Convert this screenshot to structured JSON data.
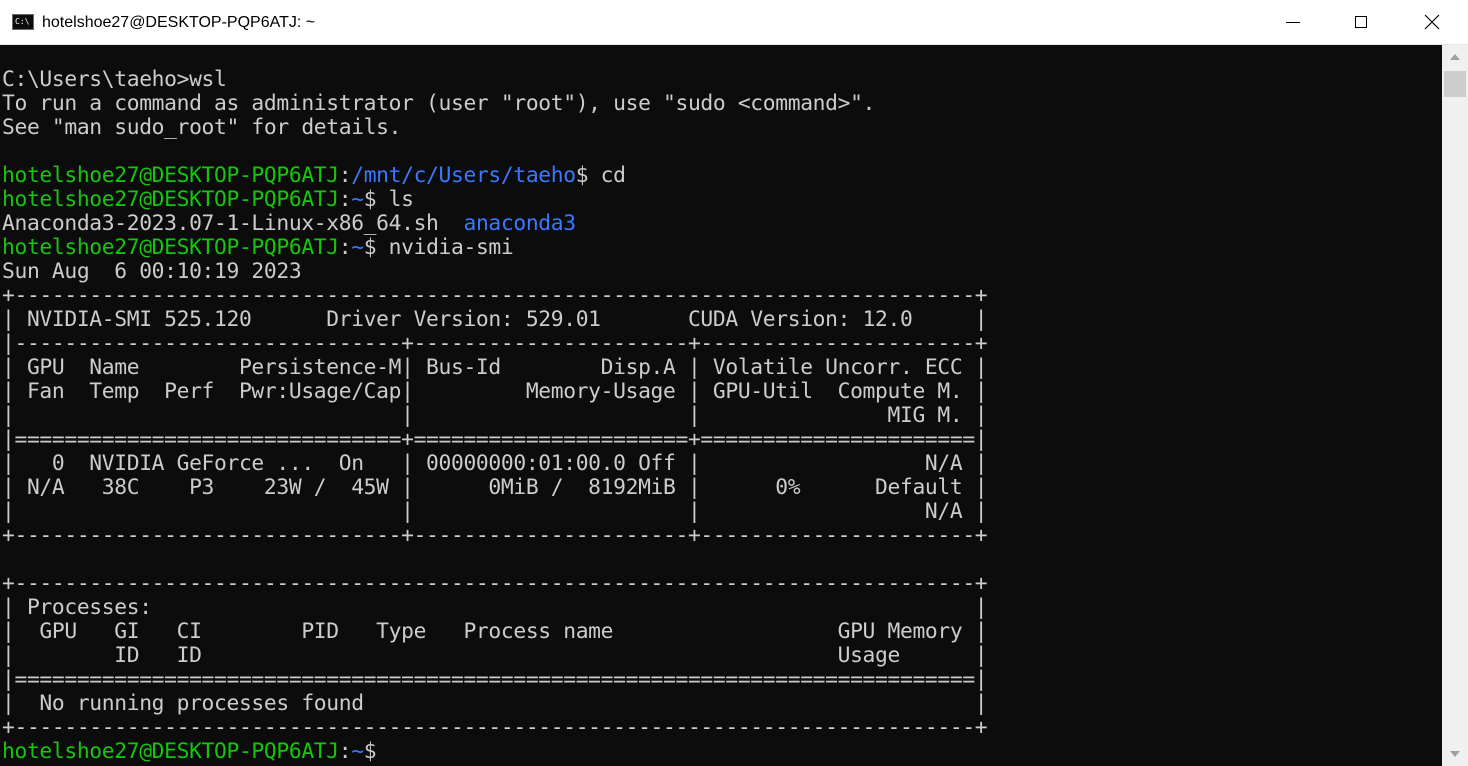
{
  "window": {
    "title": "hotelshoe27@DESKTOP-PQP6ATJ: ~",
    "icon": "C:\\",
    "icon_name": "command-prompt-icon"
  },
  "colors": {
    "background": "#0c0c0c",
    "text": "#cccccc",
    "prompt_user": "#16c60c",
    "prompt_path": "#3b78ff"
  },
  "terminal": {
    "lines": [
      {
        "segments": [
          {
            "text": "C:\\Users\\taeho>wsl",
            "color": "w"
          }
        ]
      },
      {
        "segments": [
          {
            "text": "To run a command as administrator (user \"root\"), use \"sudo <command>\".",
            "color": "w"
          }
        ]
      },
      {
        "segments": [
          {
            "text": "See \"man sudo_root\" for details.",
            "color": "w"
          }
        ]
      },
      {
        "segments": []
      },
      {
        "segments": [
          {
            "text": "hotelshoe27@DESKTOP-PQP6ATJ",
            "color": "g"
          },
          {
            "text": ":",
            "color": "w"
          },
          {
            "text": "/mnt/c/Users/taeho",
            "color": "b"
          },
          {
            "text": "$ cd",
            "color": "w"
          }
        ]
      },
      {
        "segments": [
          {
            "text": "hotelshoe27@DESKTOP-PQP6ATJ",
            "color": "g"
          },
          {
            "text": ":",
            "color": "w"
          },
          {
            "text": "~",
            "color": "b"
          },
          {
            "text": "$ ls",
            "color": "w"
          }
        ]
      },
      {
        "segments": [
          {
            "text": "Anaconda3-2023.07-1-Linux-x86_64.sh  ",
            "color": "w"
          },
          {
            "text": "anaconda3",
            "color": "b"
          }
        ]
      },
      {
        "segments": [
          {
            "text": "hotelshoe27@DESKTOP-PQP6ATJ",
            "color": "g"
          },
          {
            "text": ":",
            "color": "w"
          },
          {
            "text": "~",
            "color": "b"
          },
          {
            "text": "$ nvidia-smi",
            "color": "w"
          }
        ]
      },
      {
        "segments": [
          {
            "text": "Sun Aug  6 00:10:19 2023",
            "color": "w"
          }
        ]
      },
      {
        "segments": [
          {
            "text": "+-----------------------------------------------------------------------------+",
            "color": "w"
          }
        ]
      },
      {
        "segments": [
          {
            "text": "| NVIDIA-SMI 525.120      Driver Version: 529.01       CUDA Version: 12.0     |",
            "color": "w"
          }
        ]
      },
      {
        "segments": [
          {
            "text": "|-------------------------------+----------------------+----------------------+",
            "color": "w"
          }
        ]
      },
      {
        "segments": [
          {
            "text": "| GPU  Name        Persistence-M| Bus-Id        Disp.A | Volatile Uncorr. ECC |",
            "color": "w"
          }
        ]
      },
      {
        "segments": [
          {
            "text": "| Fan  Temp  Perf  Pwr:Usage/Cap|         Memory-Usage | GPU-Util  Compute M. |",
            "color": "w"
          }
        ]
      },
      {
        "segments": [
          {
            "text": "|                               |                      |               MIG M. |",
            "color": "w"
          }
        ]
      },
      {
        "segments": [
          {
            "text": "|===============================+======================+======================|",
            "color": "w"
          }
        ]
      },
      {
        "segments": [
          {
            "text": "|   0  NVIDIA GeForce ...  On   | 00000000:01:00.0 Off |                  N/A |",
            "color": "w"
          }
        ]
      },
      {
        "segments": [
          {
            "text": "| N/A   38C    P3    23W /  45W |      0MiB /  8192MiB |      0%      Default |",
            "color": "w"
          }
        ]
      },
      {
        "segments": [
          {
            "text": "|                               |                      |                  N/A |",
            "color": "w"
          }
        ]
      },
      {
        "segments": [
          {
            "text": "+-------------------------------+----------------------+----------------------+",
            "color": "w"
          }
        ]
      },
      {
        "segments": []
      },
      {
        "segments": [
          {
            "text": "+-----------------------------------------------------------------------------+",
            "color": "w"
          }
        ]
      },
      {
        "segments": [
          {
            "text": "| Processes:                                                                  |",
            "color": "w"
          }
        ]
      },
      {
        "segments": [
          {
            "text": "|  GPU   GI   CI        PID   Type   Process name                  GPU Memory |",
            "color": "w"
          }
        ]
      },
      {
        "segments": [
          {
            "text": "|        ID   ID                                                   Usage      |",
            "color": "w"
          }
        ]
      },
      {
        "segments": [
          {
            "text": "|=============================================================================|",
            "color": "w"
          }
        ]
      },
      {
        "segments": [
          {
            "text": "|  No running processes found                                                 |",
            "color": "w"
          }
        ]
      },
      {
        "segments": [
          {
            "text": "+-----------------------------------------------------------------------------+",
            "color": "w"
          }
        ]
      },
      {
        "segments": [
          {
            "text": "hotelshoe27@DESKTOP-PQP6ATJ",
            "color": "g"
          },
          {
            "text": ":",
            "color": "w"
          },
          {
            "text": "~",
            "color": "b"
          },
          {
            "text": "$",
            "color": "w"
          }
        ]
      }
    ]
  },
  "controls": {
    "minimize_icon": "minimize-icon",
    "maximize_icon": "maximize-icon",
    "close_icon": "close-icon",
    "scroll_up_icon": "scroll-up-arrow-icon",
    "scroll_down_icon": "scroll-down-arrow-icon"
  }
}
